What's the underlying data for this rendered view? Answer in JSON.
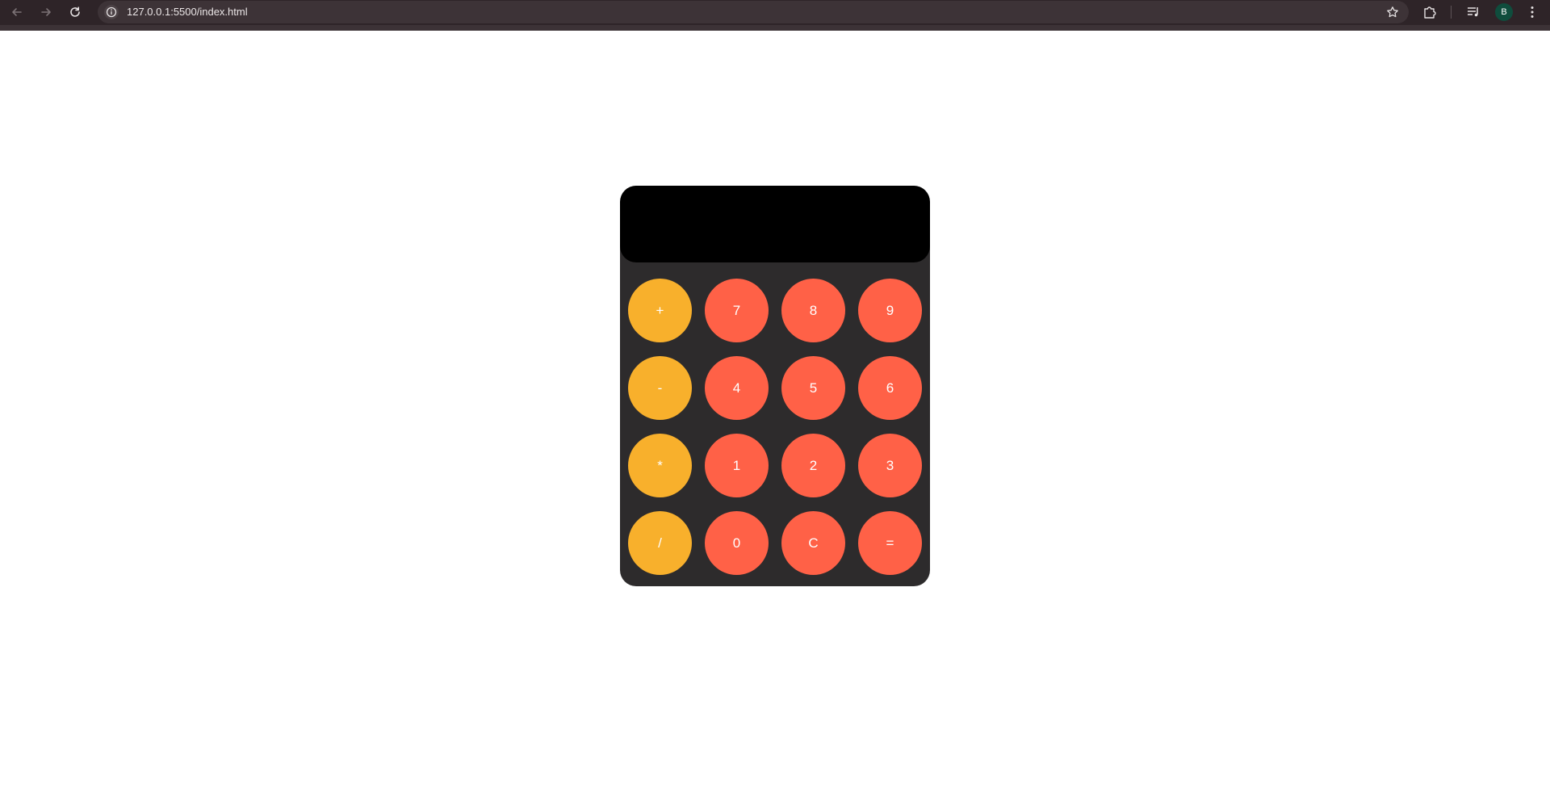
{
  "browser": {
    "url": "127.0.0.1:5500/index.html",
    "profile_initial": "B",
    "icons": {
      "back": "arrow-left-icon",
      "forward": "arrow-right-icon",
      "reload": "reload-icon",
      "site_info": "info-icon",
      "bookmark": "star-icon",
      "extensions": "puzzle-icon",
      "media": "media-queue-icon",
      "menu": "kebab-menu-icon"
    }
  },
  "calculator": {
    "display_value": "",
    "colors": {
      "operator": "#f8b02c",
      "number": "#ff6147",
      "body": "#2d2b2c",
      "display": "#000000"
    },
    "keys": [
      {
        "label": "+",
        "kind": "operator",
        "name": "key-plus"
      },
      {
        "label": "7",
        "kind": "number",
        "name": "key-7"
      },
      {
        "label": "8",
        "kind": "number",
        "name": "key-8"
      },
      {
        "label": "9",
        "kind": "number",
        "name": "key-9"
      },
      {
        "label": "-",
        "kind": "operator",
        "name": "key-minus"
      },
      {
        "label": "4",
        "kind": "number",
        "name": "key-4"
      },
      {
        "label": "5",
        "kind": "number",
        "name": "key-5"
      },
      {
        "label": "6",
        "kind": "number",
        "name": "key-6"
      },
      {
        "label": "*",
        "kind": "operator",
        "name": "key-multiply"
      },
      {
        "label": "1",
        "kind": "number",
        "name": "key-1"
      },
      {
        "label": "2",
        "kind": "number",
        "name": "key-2"
      },
      {
        "label": "3",
        "kind": "number",
        "name": "key-3"
      },
      {
        "label": "/",
        "kind": "operator",
        "name": "key-divide"
      },
      {
        "label": "0",
        "kind": "number",
        "name": "key-0"
      },
      {
        "label": "C",
        "kind": "number",
        "name": "key-clear"
      },
      {
        "label": "=",
        "kind": "number",
        "name": "key-equals"
      }
    ]
  }
}
